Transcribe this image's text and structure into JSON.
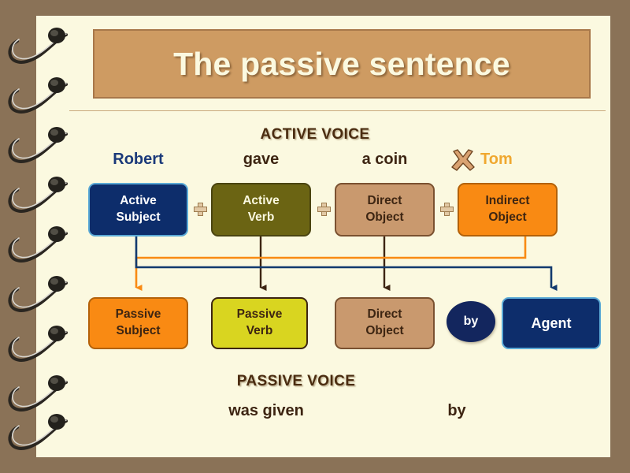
{
  "slide": {
    "title": "The passive sentence",
    "background_frame_color": "#8a7257",
    "page_color": "#fbf9e0",
    "title_fill": "#ce9b62",
    "title_text_color": "#fbf9e0"
  },
  "sections": {
    "active_heading": "ACTIVE VOICE",
    "passive_heading": "PASSIVE VOICE"
  },
  "example": {
    "active_words": [
      {
        "text": "Robert",
        "color": "#1b3a7a"
      },
      {
        "text": "gave",
        "color": "#3d2512"
      },
      {
        "text": "a coin",
        "color": "#3d2512"
      },
      {
        "text": "Tom",
        "color": "#f0a830"
      }
    ],
    "passive_words": [
      {
        "text": "was given",
        "color": "#3d2512"
      },
      {
        "text": "by",
        "color": "#3d2512"
      }
    ],
    "cross_icon": "x-mark-icon"
  },
  "active_row": [
    {
      "line1": "Active",
      "line2": "Subject",
      "fill": "#0d2d6b",
      "border": "#5aa9d6",
      "text_color": "#ffffff"
    },
    {
      "line1": "Active",
      "line2": "Verb",
      "fill": "#6b6413",
      "border": "#4a4410",
      "text_color": "#fbf9e0"
    },
    {
      "line1": "Direct",
      "line2": "Object",
      "fill": "#c9996e",
      "border": "#7a5130",
      "text_color": "#3d2512"
    },
    {
      "line1": "Indirect",
      "line2": "Object",
      "fill": "#f98a13",
      "border": "#b3620a",
      "text_color": "#3d2512"
    }
  ],
  "passive_row": [
    {
      "line1": "Passive",
      "line2": "Subject",
      "fill": "#f98a13",
      "border": "#b3620a",
      "text_color": "#3d2512"
    },
    {
      "line1": "Passive",
      "line2": "Verb",
      "fill": "#d9d520",
      "border": "#3d2512",
      "text_color": "#3d2512"
    },
    {
      "line1": "Direct",
      "line2": "Object",
      "fill": "#c9996e",
      "border": "#7a5130",
      "text_color": "#3d2512"
    },
    {
      "line1": "Agent",
      "line2": "",
      "fill": "#0d2d6b",
      "border": "#5aa9d6",
      "text_color": "#ffffff"
    }
  ],
  "by_bubble": {
    "label": "by",
    "fill": "#13265e"
  },
  "connectors": {
    "subject_to_agent_color": "#123a6e",
    "indirect_to_subject_color": "#f98a13",
    "straight_color": "#3d2512",
    "plus_icon": "plus-icon"
  }
}
